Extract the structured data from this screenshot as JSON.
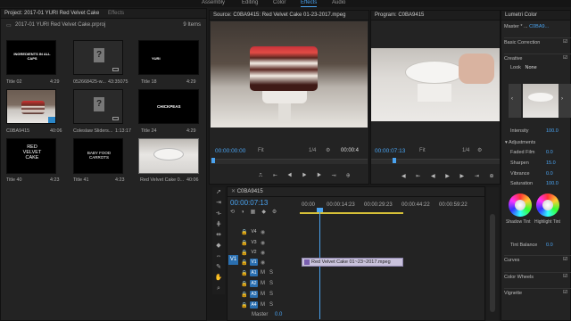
{
  "workspaces": [
    "Assembly",
    "Editing",
    "Color",
    "Effects",
    "Audio"
  ],
  "project": {
    "tab": "Project: 2017-01 YURI Red Velvet Cake",
    "tab2": "Effects",
    "filename": "2017-01 YURI Red Velvet Cake.prproj",
    "item_count": "9 Items",
    "items": [
      {
        "name": "Title 02",
        "duration": "4:29",
        "kind": "title",
        "text": "INGREDIENTS IN ALL CAPS"
      },
      {
        "name": "052668425-w...",
        "duration": "43:35075",
        "kind": "missing"
      },
      {
        "name": "Title 18",
        "duration": "4:29",
        "kind": "title",
        "text": "YURI"
      },
      {
        "name": "C0BA9415",
        "duration": "40:06",
        "kind": "cake"
      },
      {
        "name": "Coleslaw Sliders...",
        "duration": "1:13:17",
        "kind": "missing"
      },
      {
        "name": "Title 24",
        "duration": "4:29",
        "kind": "title",
        "text": "CHICKPEAS"
      },
      {
        "name": "Title 40",
        "duration": "4:23",
        "kind": "title",
        "text": "RED VELVET CAKE"
      },
      {
        "name": "Title 41",
        "duration": "4:23",
        "kind": "title",
        "text": "BABY FOOD CARROTS"
      },
      {
        "name": "Red Velvet Cake 0...",
        "duration": "40:06",
        "kind": "plate"
      }
    ]
  },
  "source": {
    "tab": "Source: C0BA9415: Red Velvet Cake 01-23-2017.mpeg",
    "timecode": "00:00:00:00",
    "fit": "Fit",
    "ratio": "1/4",
    "end_timecode": "00:00:4"
  },
  "program": {
    "tab": "Program: C0BA9415",
    "timecode": "00:00:07:13",
    "fit": "Fit",
    "ratio": "1/4"
  },
  "timeline": {
    "tab": "C0BA9415",
    "timecode": "00:00:07:13",
    "ruler": [
      "00:00",
      "00:00:14:23",
      "00:00:29:23",
      "00:00:44:22",
      "00:00:59:22"
    ],
    "tracks": [
      "V4",
      "V3",
      "V2",
      "V1",
      "A1",
      "A2",
      "A3",
      "A4"
    ],
    "src_patch": "V1",
    "master_label": "Master",
    "master_value": "0.0",
    "clip": "Red Velvet Cake 01~23~2017.mpeg"
  },
  "lumetri": {
    "tab": "Lumetri Color",
    "master": "Master * ...",
    "clip": "C0BA9...",
    "basic": "Basic Correction",
    "creative": "Creative",
    "look_label": "Look",
    "look_value": "None",
    "intensity_label": "Intensity",
    "intensity_value": "100.0",
    "adjustments": "Adjustments",
    "rows": [
      {
        "label": "Faded Film",
        "value": "0.0"
      },
      {
        "label": "Sharpen",
        "value": "15.0"
      },
      {
        "label": "Vibrance",
        "value": "0.0"
      },
      {
        "label": "Saturation",
        "value": "100.0"
      }
    ],
    "shadow_tint": "Shadow Tint",
    "highlight_tint": "Highlight Tint",
    "tint_balance_label": "Tint Balance",
    "tint_balance_value": "0.0",
    "curves": "Curves",
    "color_wheels": "Color Wheels",
    "vignette": "Vignette"
  }
}
